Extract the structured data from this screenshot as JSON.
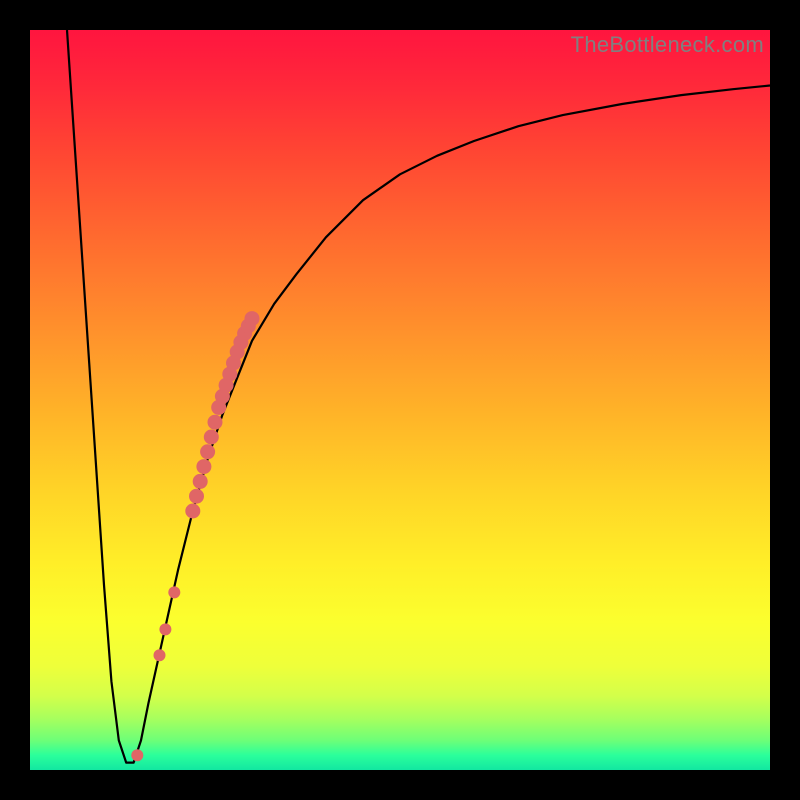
{
  "watermark": "TheBottleneck.com",
  "chart_data": {
    "type": "line",
    "title": "",
    "xlabel": "",
    "ylabel": "",
    "xlim": [
      0,
      100
    ],
    "ylim": [
      0,
      100
    ],
    "grid": false,
    "series": [
      {
        "name": "curve",
        "color": "#000000",
        "x": [
          5,
          6,
          7,
          8,
          9,
          10,
          11,
          12,
          13,
          14,
          15,
          16,
          18,
          20,
          22,
          24,
          26,
          28,
          30,
          33,
          36,
          40,
          45,
          50,
          55,
          60,
          66,
          72,
          80,
          88,
          95,
          100
        ],
        "y": [
          100,
          85,
          70,
          55,
          40,
          25,
          12,
          4,
          1,
          1,
          4,
          9,
          18,
          27,
          35,
          42,
          48,
          53,
          58,
          63,
          67,
          72,
          77,
          80.5,
          83,
          85,
          87,
          88.5,
          90,
          91.2,
          92,
          92.5
        ]
      },
      {
        "name": "highlight-top",
        "type": "scatter",
        "color": "#e06666",
        "x": [
          22,
          22.5,
          23,
          23.5,
          24,
          24.5,
          25,
          25.5,
          26,
          26.5,
          27,
          27.5,
          28,
          28.5,
          29,
          29.5,
          30
        ],
        "y": [
          35,
          37,
          39,
          41,
          43,
          45,
          47,
          49,
          50.5,
          52,
          53.5,
          55,
          56.5,
          57.8,
          59,
          60,
          61
        ]
      },
      {
        "name": "highlight-bottom",
        "type": "scatter",
        "color": "#e06666",
        "x": [
          17.5,
          18.3,
          19.5,
          14.5
        ],
        "y": [
          15.5,
          19,
          24,
          2
        ]
      }
    ]
  }
}
